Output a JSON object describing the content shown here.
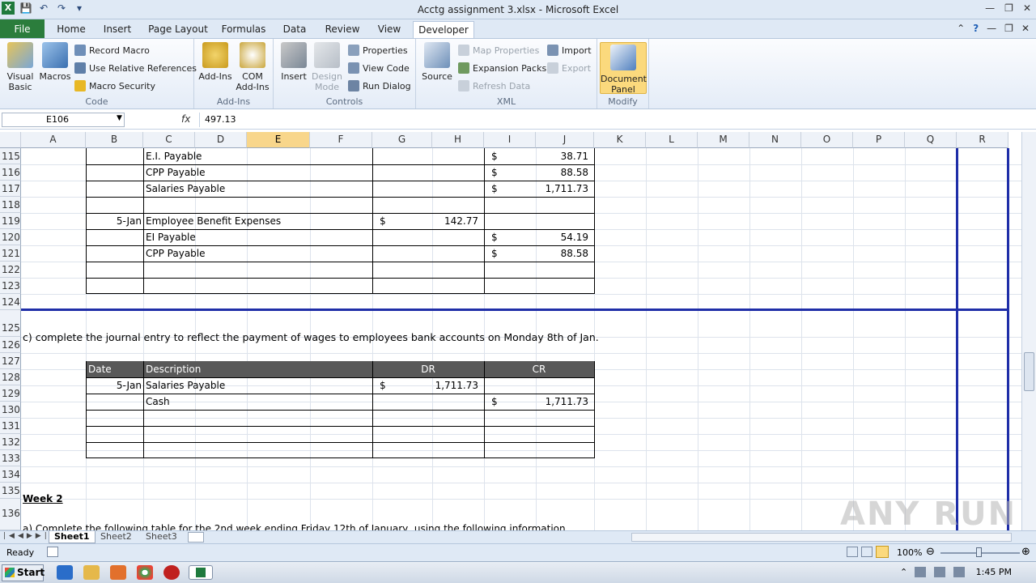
{
  "window": {
    "title": "Acctg assignment 3.xlsx - Microsoft Excel"
  },
  "tabs": [
    {
      "label": "File"
    },
    {
      "label": "Home"
    },
    {
      "label": "Insert"
    },
    {
      "label": "Page Layout"
    },
    {
      "label": "Formulas"
    },
    {
      "label": "Data"
    },
    {
      "label": "Review"
    },
    {
      "label": "View"
    },
    {
      "label": "Developer"
    }
  ],
  "ribbon": {
    "code": {
      "label": "Code",
      "visual_basic": "Visual Basic",
      "macros": "Macros",
      "record_macro": "Record Macro",
      "relative_refs": "Use Relative References",
      "macro_security": "Macro Security"
    },
    "addins": {
      "label": "Add-Ins",
      "addins": "Add-Ins",
      "com_addins": "COM Add-Ins"
    },
    "controls": {
      "label": "Controls",
      "insert": "Insert",
      "design_mode": "Design Mode",
      "properties": "Properties",
      "view_code": "View Code",
      "run_dialog": "Run Dialog"
    },
    "xml": {
      "label": "XML",
      "source": "Source",
      "map_properties": "Map Properties",
      "expansion_packs": "Expansion Packs",
      "refresh_data": "Refresh Data",
      "import": "Import",
      "export": "Export"
    },
    "modify": {
      "label": "Modify",
      "document_panel": "Document Panel"
    }
  },
  "formula_bar": {
    "name_box": "E106",
    "fx": "fx",
    "value": "497.13"
  },
  "columns": [
    "A",
    "B",
    "C",
    "D",
    "E",
    "F",
    "G",
    "H",
    "I",
    "J",
    "K",
    "L",
    "M",
    "N",
    "O",
    "P",
    "Q",
    "R"
  ],
  "rows": [
    "115",
    "116",
    "117",
    "118",
    "119",
    "120",
    "121",
    "122",
    "123",
    "124",
    "125",
    "126",
    "127",
    "128",
    "129",
    "130",
    "131",
    "132",
    "133",
    "134",
    "135",
    "136"
  ],
  "cells": {
    "r115c": "E.I. Payable",
    "r115i": "$",
    "r115j": "38.71",
    "r116c": "CPP Payable",
    "r116i": "$",
    "r116j": "88.58",
    "r117c": "Salaries Payable",
    "r117i": "$",
    "r117j": "1,711.73",
    "r119b": "5-Jan",
    "r119c": "Employee Benefit Expenses",
    "r119g": "$",
    "r119h": "142.77",
    "r120c": "EI Payable",
    "r120i": "$",
    "r120j": "54.19",
    "r121c": "CPP Payable",
    "r121i": "$",
    "r121j": "88.58",
    "r125a": "c) complete the journal entry to reflect the payment of wages to employees bank accounts on Monday 8th of Jan.",
    "r127_date": "Date",
    "r127_desc": "Description",
    "r127_dr": "DR",
    "r127_cr": "CR",
    "r128b": "5-Jan",
    "r128c": "Salaries Payable",
    "r128g": "$",
    "r128h": "1,711.73",
    "r129c": "Cash",
    "r129i": "$",
    "r129j": "1,711.73",
    "r135a": "Week 2",
    "r136a": "a) Complete the following table for the 2nd week ending Friday 12th of January, using the following information"
  },
  "sheets": [
    "Sheet1",
    "Sheet2",
    "Sheet3"
  ],
  "status": {
    "ready": "Ready",
    "zoom": "100%"
  },
  "taskbar": {
    "start": "Start",
    "time": "1:45 PM"
  },
  "watermark": "ANY RUN"
}
